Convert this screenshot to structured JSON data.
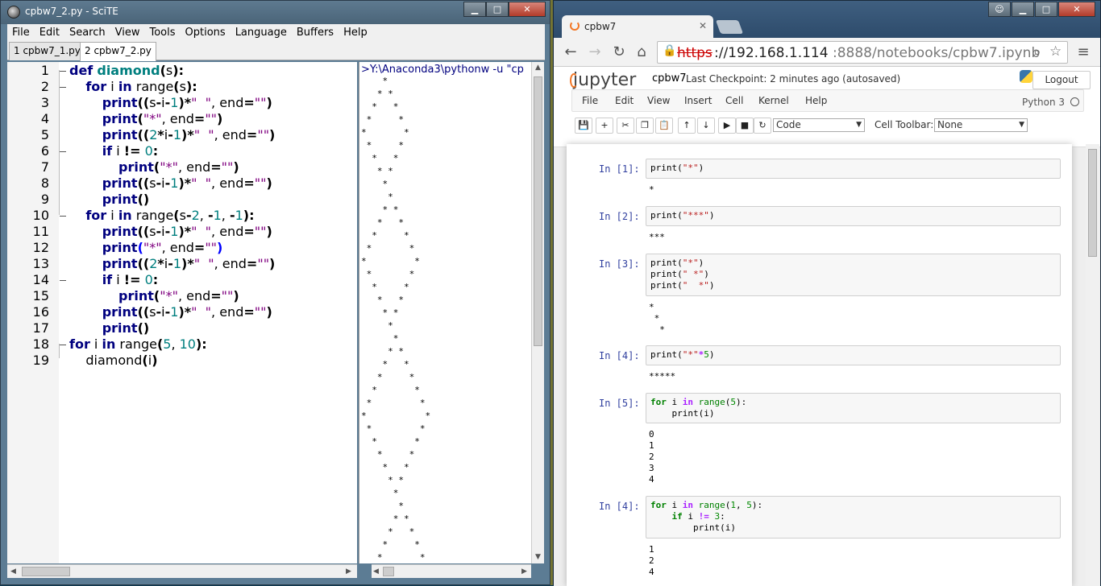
{
  "scite": {
    "title": "cpbw7_2.py - SciTE",
    "menu": [
      "File",
      "Edit",
      "Search",
      "View",
      "Tools",
      "Options",
      "Language",
      "Buffers",
      "Help"
    ],
    "tabs": [
      "1 cpbw7_1.py",
      "2 cpbw7_2.py"
    ],
    "line_numbers": [
      "1",
      "2",
      "3",
      "4",
      "5",
      "6",
      "7",
      "8",
      "9",
      "10",
      "11",
      "12",
      "13",
      "14",
      "15",
      "16",
      "17",
      "18",
      "19"
    ],
    "output_command": ">Y:\\Anaconda3\\pythonw -u \"cp",
    "output_lines": [
      "    *",
      "   * *",
      "  *   *",
      " *     *",
      "*       *",
      " *     *",
      "  *   *",
      "   * *",
      "    *",
      "     *",
      "    * *",
      "   *   *",
      "  *     *",
      " *       *",
      "*         *",
      " *       *",
      "  *     *",
      "   *   *",
      "    * *",
      "     *",
      "      *",
      "     * *",
      "    *   *",
      "   *     *",
      "  *       *",
      " *         *",
      "*           *",
      " *         *",
      "  *       *",
      "   *     *",
      "    *   *",
      "     * *",
      "      *",
      "       *",
      "      * *",
      "     *   *",
      "    *     *",
      "   *       *"
    ]
  },
  "browser": {
    "tab_title": "cpbw7",
    "url_scheme": "https",
    "url_rest": "://192.168.1.114",
    "url_port_path": ":8888/notebooks/cpbw7.ipynb",
    "jupyter_logo": "jupyter",
    "notebook_name": "cpbw7",
    "checkpoint": "Last Checkpoint: 2 minutes ago (autosaved)",
    "logout": "Logout",
    "menu": [
      "File",
      "Edit",
      "View",
      "Insert",
      "Cell",
      "Kernel",
      "Help"
    ],
    "kernel": "Python 3",
    "cell_type": "Code",
    "cell_toolbar_label": "Cell Toolbar:",
    "cell_toolbar_value": "None",
    "cells": [
      {
        "prompt": "In [1]:",
        "output": "*"
      },
      {
        "prompt": "In [2]:",
        "output": "***"
      },
      {
        "prompt": "In [3]:",
        "output": "*\n *\n  *"
      },
      {
        "prompt": "In [4]:",
        "output": "*****"
      },
      {
        "prompt": "In [5]:",
        "output": "0\n1\n2\n3\n4"
      },
      {
        "prompt": "In [4]:",
        "output": "1\n2\n4"
      }
    ]
  }
}
